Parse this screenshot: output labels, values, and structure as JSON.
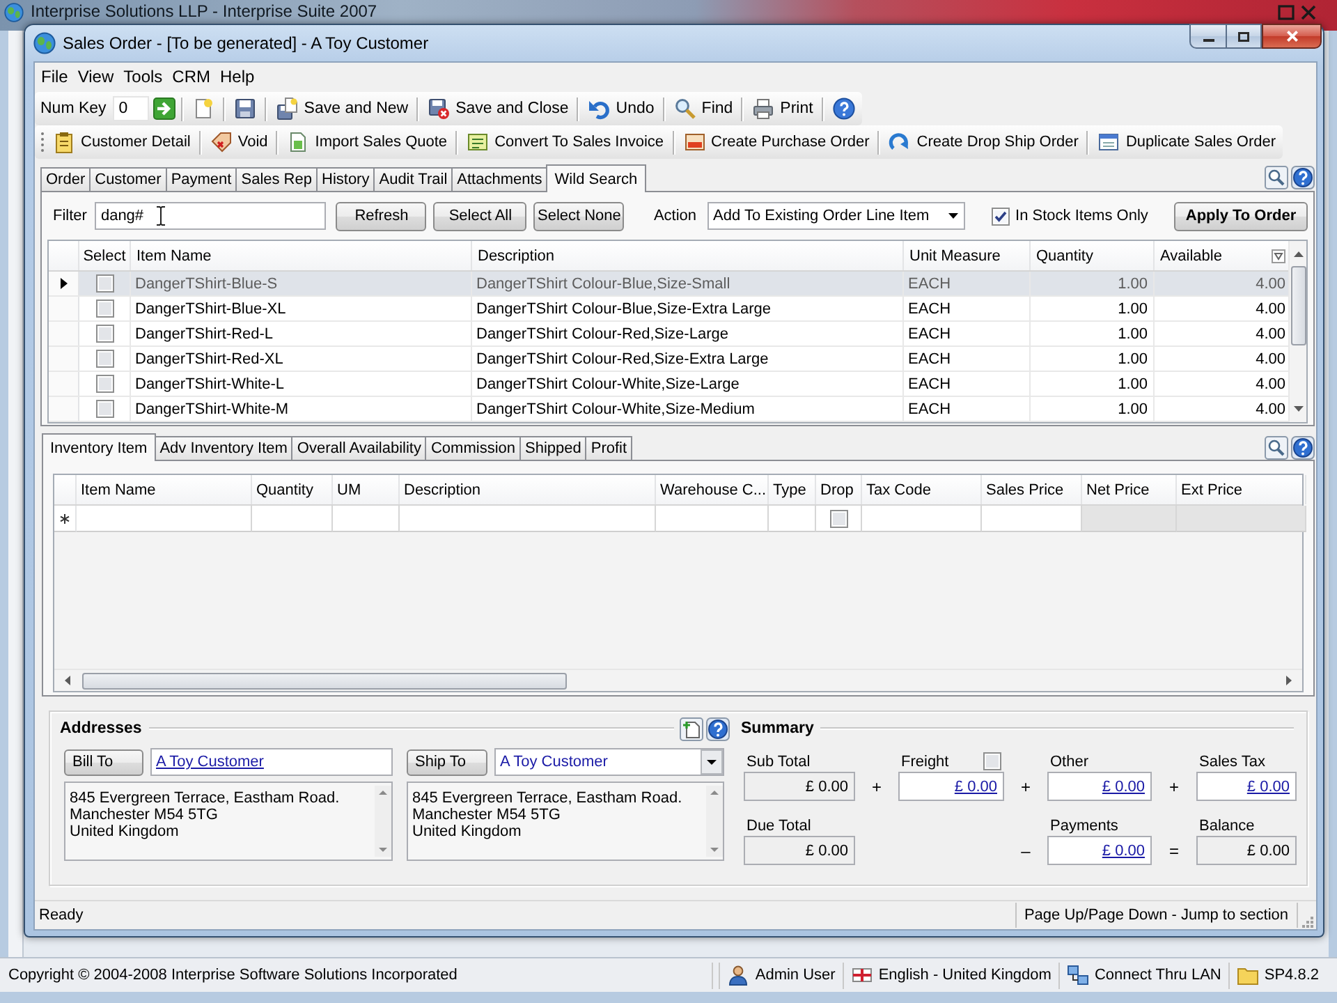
{
  "app": {
    "title": "Interprise Solutions LLP - Interprise Suite 2007"
  },
  "window": {
    "title": "Sales Order - [To be generated] - A Toy Customer"
  },
  "menu": [
    "File",
    "View",
    "Tools",
    "CRM",
    "Help"
  ],
  "toolbar": {
    "num_key": {
      "label": "Num Key",
      "value": "0"
    },
    "buttons": [
      "Save and New",
      "Save and Close",
      "Undo",
      "Find",
      "Print"
    ]
  },
  "action_bar": [
    "Customer Detail",
    "Void",
    "Import Sales Quote",
    "Convert To Sales Invoice",
    "Create Purchase Order",
    "Create Drop Ship Order",
    "Duplicate Sales Order"
  ],
  "tabs": [
    {
      "label": "Order",
      "selected": false
    },
    {
      "label": "Customer",
      "selected": false
    },
    {
      "label": "Payment",
      "selected": false
    },
    {
      "label": "Sales Rep",
      "selected": false
    },
    {
      "label": "History",
      "selected": false
    },
    {
      "label": "Audit Trail",
      "selected": false
    },
    {
      "label": "Attachments",
      "selected": false
    },
    {
      "label": "Wild Search",
      "selected": true
    }
  ],
  "wild_search": {
    "filter": {
      "label": "Filter",
      "value": "dang#"
    },
    "buttons": [
      "Refresh",
      "Select All",
      "Select None"
    ],
    "action": {
      "label": "Action",
      "value": "Add To Existing Order Line Item"
    },
    "in_stock_only": {
      "label": "In Stock Items Only",
      "checked": true
    },
    "apply_button": "Apply To Order",
    "select_column": {
      "label": "Select"
    },
    "columns": [
      {
        "label": "Item Name",
        "kind": "text"
      },
      {
        "label": "Description",
        "kind": "text"
      },
      {
        "label": "Unit Measure",
        "kind": "text"
      },
      {
        "label": "Quantity",
        "kind": "number"
      },
      {
        "label": "Available",
        "kind": "number"
      }
    ],
    "rows": [
      {
        "selected": true,
        "checked": false,
        "cells": [
          "DangerTShirt-Blue-S",
          "DangerTShirt Colour-Blue,Size-Small",
          "EACH",
          "1.00",
          "4.00"
        ]
      },
      {
        "selected": false,
        "checked": false,
        "cells": [
          "DangerTShirt-Blue-XL",
          "DangerTShirt Colour-Blue,Size-Extra Large",
          "EACH",
          "1.00",
          "4.00"
        ]
      },
      {
        "selected": false,
        "checked": false,
        "cells": [
          "DangerTShirt-Red-L",
          "DangerTShirt Colour-Red,Size-Large",
          "EACH",
          "1.00",
          "4.00"
        ]
      },
      {
        "selected": false,
        "checked": false,
        "cells": [
          "DangerTShirt-Red-XL",
          "DangerTShirt Colour-Red,Size-Extra Large",
          "EACH",
          "1.00",
          "4.00"
        ]
      },
      {
        "selected": false,
        "checked": false,
        "cells": [
          "DangerTShirt-White-L",
          "DangerTShirt Colour-White,Size-Large",
          "EACH",
          "1.00",
          "4.00"
        ]
      },
      {
        "selected": false,
        "checked": false,
        "cells": [
          "DangerTShirt-White-M",
          "DangerTShirt Colour-White,Size-Medium",
          "EACH",
          "1.00",
          "4.00"
        ]
      }
    ]
  },
  "detail_tabs": [
    {
      "label": "Inventory Item",
      "selected": true
    },
    {
      "label": "Adv Inventory Item",
      "selected": false
    },
    {
      "label": "Overall Availability",
      "selected": false
    },
    {
      "label": "Commission",
      "selected": false
    },
    {
      "label": "Shipped",
      "selected": false
    },
    {
      "label": "Profit",
      "selected": false
    }
  ],
  "lines": {
    "columns": [
      {
        "label": "Item Name",
        "kind": "text",
        "readonly": false
      },
      {
        "label": "Quantity",
        "kind": "text",
        "readonly": false
      },
      {
        "label": "UM",
        "kind": "text",
        "readonly": false
      },
      {
        "label": "Description",
        "kind": "text",
        "readonly": false
      },
      {
        "label": "Warehouse C...",
        "kind": "text",
        "readonly": false
      },
      {
        "label": "Type",
        "kind": "text",
        "readonly": false
      },
      {
        "label": "Drop",
        "kind": "check",
        "readonly": false
      },
      {
        "label": "Tax Code",
        "kind": "text",
        "readonly": false
      },
      {
        "label": "Sales Price",
        "kind": "text",
        "readonly": false
      },
      {
        "label": "Net Price",
        "kind": "text",
        "readonly": true
      },
      {
        "label": "Ext Price",
        "kind": "text",
        "readonly": true
      }
    ],
    "new_row": {
      "checked": false
    }
  },
  "addresses": {
    "title": "Addresses",
    "parties": [
      {
        "button": "Bill To",
        "customer": "A Toy Customer",
        "link": true,
        "dropdown": false,
        "address": "845 Evergreen Terrace, Eastham Road.\nManchester M54 5TG\nUnited Kingdom"
      },
      {
        "button": "Ship To",
        "customer": "A Toy Customer",
        "link": false,
        "dropdown": true,
        "address": "845 Evergreen Terrace, Eastham Road.\nManchester M54 5TG\nUnited Kingdom"
      }
    ]
  },
  "summary": {
    "title": "Summary",
    "top_row": [
      {
        "label": "Sub Total",
        "value": "£ 0.00",
        "link": false
      },
      {
        "operator": "+",
        "label": "Freight",
        "value": "£ 0.00",
        "link": true,
        "checked": false
      },
      {
        "operator": "+",
        "label": "Other",
        "value": "£ 0.00",
        "link": true
      },
      {
        "operator": "+",
        "label": "Sales Tax",
        "value": "£ 0.00",
        "link": true
      }
    ],
    "bottom_row": [
      {
        "label": "Due Total",
        "value": "£ 0.00",
        "link": false
      },
      {
        "operator": "–",
        "label": "Payments",
        "value": "£ 0.00",
        "link": true
      },
      {
        "operator": "=",
        "label": "Balance",
        "value": "£ 0.00",
        "link": false
      }
    ]
  },
  "status_bar": {
    "message": "Ready",
    "hint": "Page Up/Page Down - Jump to section"
  },
  "app_status_bar": {
    "copyright": "Copyright © 2004-2008 Interprise Software Solutions Incorporated",
    "panels": [
      "Admin User",
      "English - United Kingdom",
      "Connect Thru LAN",
      "SP4.8.2"
    ]
  }
}
